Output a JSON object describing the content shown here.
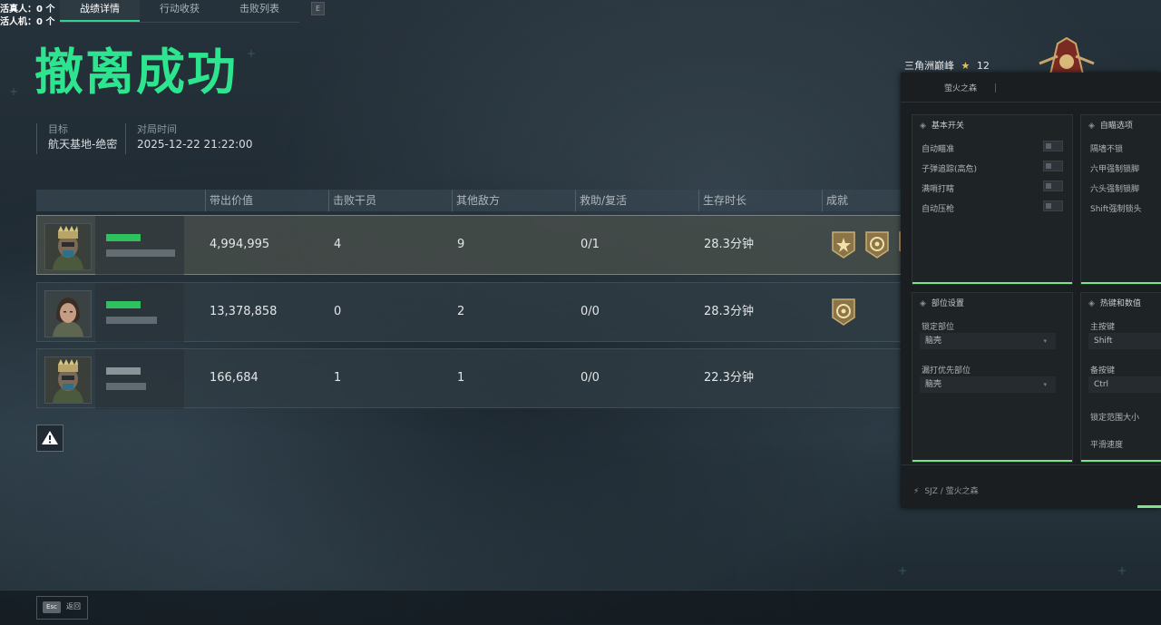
{
  "counts": {
    "real_players": "活真人：0 个",
    "bots": "活人机：0 个"
  },
  "tabs": [
    {
      "label": "战绩详情",
      "active": true
    },
    {
      "label": "行动收获",
      "active": false
    },
    {
      "label": "击败列表",
      "active": false
    }
  ],
  "tab_key": "E",
  "title": "撤离成功",
  "meta": {
    "target_label": "目标",
    "target_value": "航天基地-绝密",
    "time_label": "对局时间",
    "time_value": "2025-12-22 21:22:00"
  },
  "table": {
    "headers": [
      "带出价值",
      "击败干员",
      "其他敌方",
      "救助/复活",
      "生存时长",
      "成就"
    ],
    "rows": [
      {
        "value": "4,994,995",
        "kills": "4",
        "other": "9",
        "rescue": "0/1",
        "survival": "28.3分钟",
        "medals": 3,
        "highlighted": true
      },
      {
        "value": "13,378,858",
        "kills": "0",
        "other": "2",
        "rescue": "0/0",
        "survival": "28.3分钟",
        "medals": 1,
        "highlighted": false
      },
      {
        "value": "166,684",
        "kills": "1",
        "other": "1",
        "rescue": "0/0",
        "survival": "22.3分钟",
        "medals": 0,
        "highlighted": false
      }
    ]
  },
  "rank": {
    "name": "三角洲巅峰",
    "star": "★",
    "level": "12"
  },
  "bottom": {
    "esc_key": "Esc",
    "back_label": "返回"
  },
  "panel": {
    "tab_label": "萤火之森",
    "basic": {
      "title": "基本开关",
      "options": [
        "自动瞄准",
        "子弹追踪(高危)",
        "满哨打瞎",
        "自动压枪"
      ]
    },
    "aim": {
      "title": "自瞄选项",
      "options": [
        "隔墙不锁",
        "六甲强制锁脚",
        "六头强制锁脚",
        "Shift强制锁头"
      ]
    },
    "parts": {
      "title": "部位设置",
      "lock_label": "锁定部位",
      "lock_value": "脑壳",
      "priority_label": "漏打优先部位",
      "priority_value": "脑壳"
    },
    "hotkeys": {
      "title": "热键和数值",
      "main_label": "主按键",
      "main_value": "Shift",
      "backup_label": "备按键",
      "backup_value": "Ctrl",
      "range_label": "锁定范围大小",
      "smooth_label": "平滑速度"
    },
    "footer": "SJZ / 萤火之森"
  },
  "colors": {
    "accent_green": "#2ee58f",
    "panel_green": "#7de28a"
  }
}
